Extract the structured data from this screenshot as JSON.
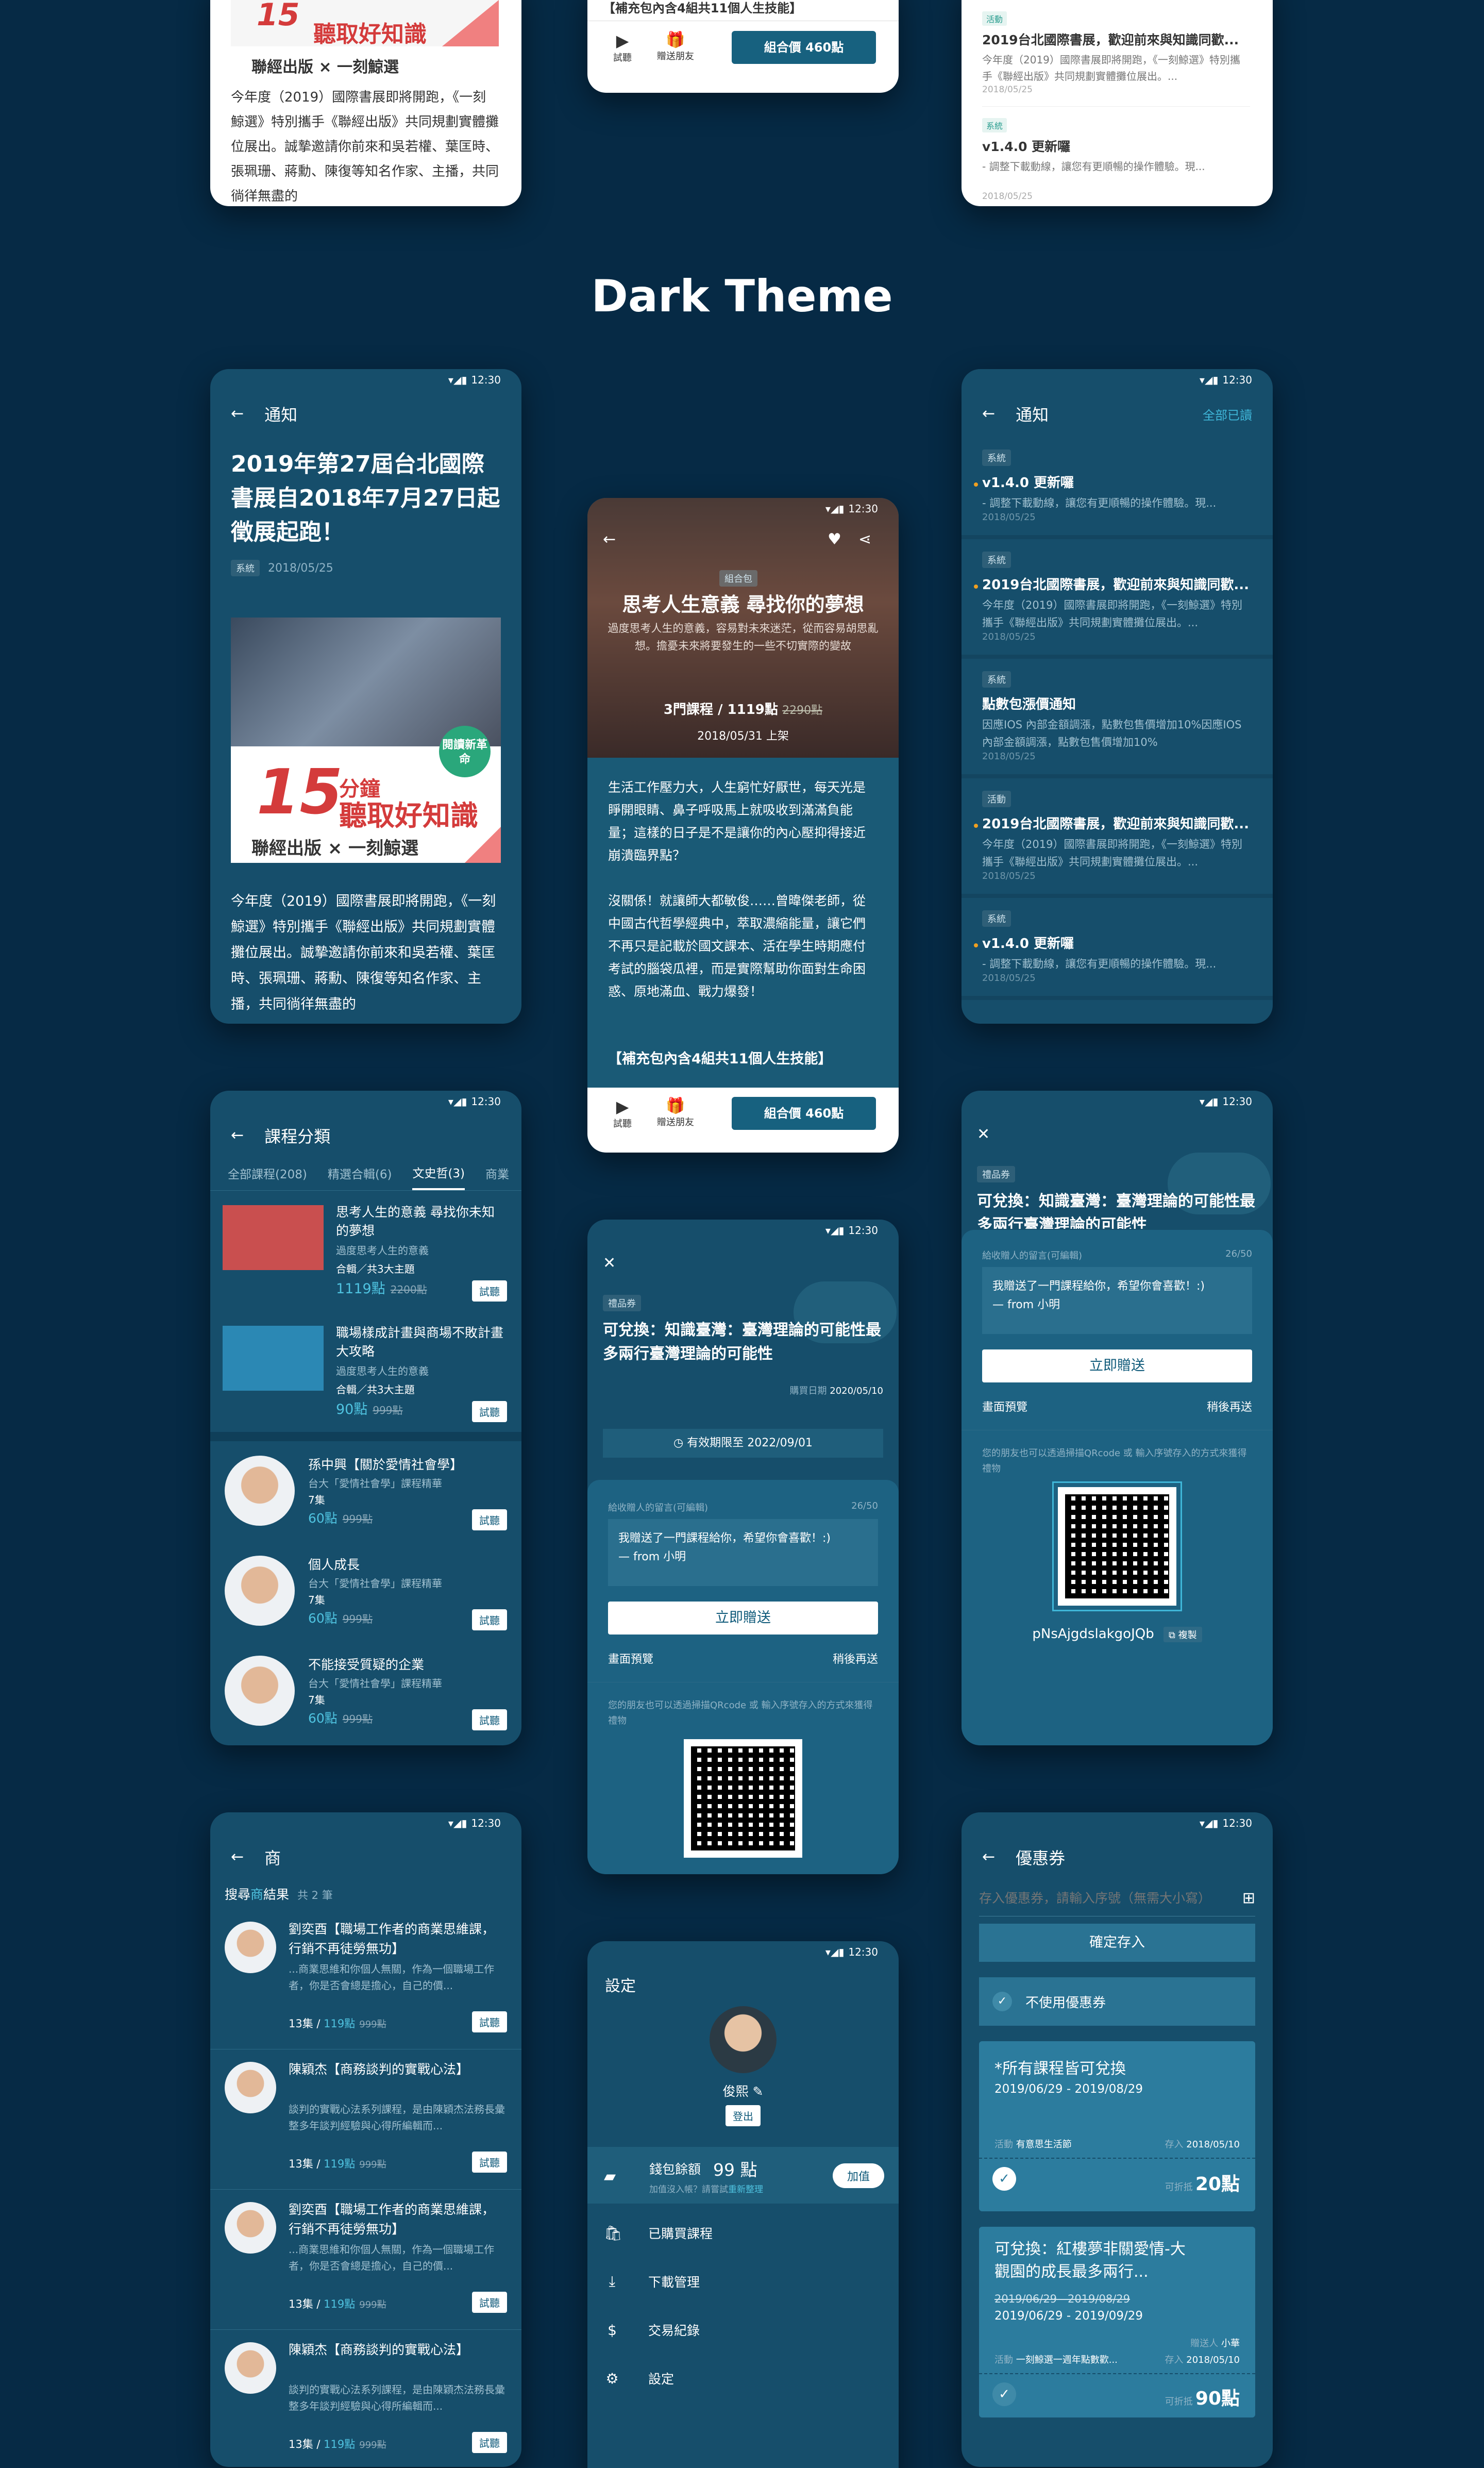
{
  "section_title": "Dark Theme",
  "status": {
    "time": "12:30"
  },
  "top": {
    "logo_caption": "聯經出版 × 一刻鯨選",
    "headline_frag": "聽取好知識",
    "headline_num": "15",
    "body": "今年度（2019）國際書展即將開跑，《一刻鯨選》特別攜手《聯經出版》共同規劃實體攤位展出。誠摯邀請你前來和吳若權、葉匡時、張珮珊、蔣勳、陳復等知名作家、主播，共同徜徉無盡的",
    "bundle_tail": "【補充包內含4組共11個人生技能】",
    "try_label": "試聽",
    "gift_label": "贈送朋友",
    "buy_label": "組合價 460點",
    "notif_items": [
      {
        "tag": "活動",
        "title": "2019台北國際書展，歡迎前來與知識同歡...",
        "desc": "今年度（2019）國際書展即將開跑，《一刻鯨選》特別攜手《聯經出版》共同規劃實體攤位展出。...",
        "date": "2018/05/25"
      },
      {
        "tag": "系統",
        "title": "v1.4.0 更新囉",
        "desc": "- 調整下載動線，讓您有更順暢的操作體驗。現...",
        "date": "2018/05/25"
      }
    ]
  },
  "article": {
    "nav_title": "通知",
    "title": "2019年第27屆台北國際書展自2018年7月27日起徵展起跑！",
    "tag": "系統",
    "date": "2018/05/25",
    "banner_tag": "閱讀新革命",
    "banner_num": "15",
    "banner_unit": "分鐘",
    "banner_text": "聽取好知識",
    "banner_logo": "聯經出版 × 一刻鯨選",
    "body": "今年度（2019）國際書展即將開跑，《一刻鯨選》特別攜手《聯經出版》共同規劃實體攤位展出。誠摯邀請你前來和吳若權、葉匡時、張珮珊、蔣勳、陳復等知名作家、主播，共同徜徉無盡的"
  },
  "bundle": {
    "tag": "組合包",
    "title": "思考人生意義 尋找你的夢想",
    "subtitle": "過度思考人生的意義，容易對未來迷茫，從而容易胡思亂想。擔憂未來將要發生的一些不切實際的變故",
    "count": "3門課程 / 1119點",
    "orig": "2290點",
    "date": "2018/05/31 上架",
    "p1": "生活工作壓力大，人生窮忙好厭世，每天光是睜開眼睛、鼻子呼吸馬上就吸收到滿滿負能量；這樣的日子是不是讓你的內心壓抑得接近崩潰臨界點？",
    "p2": "沒關係！就讓師大都敏俊……曾暐傑老師，從中國古代哲學經典中，萃取濃縮能量，讓它們不再只是記載於國文課本、活在學生時期應付考試的腦袋瓜裡，而是實際幫助你面對生命困惑、原地滿血、戰力爆發！",
    "tail": "【補充包內含4組共11個人生技能】",
    "try": "試聽",
    "gift": "贈送朋友",
    "buy": "組合價 460點"
  },
  "notif_list": {
    "nav_title": "通知",
    "mark_all": "全部已讀",
    "items": [
      {
        "tag": "系統",
        "title": "v1.4.0 更新囉",
        "desc": "- 調整下載動線，讓您有更順暢的操作體驗。現...",
        "date": "2018/05/25",
        "dot": true
      },
      {
        "tag": "系統",
        "title": "2019台北國際書展，歡迎前來與知識同歡...",
        "desc": "今年度（2019）國際書展即將開跑，《一刻鯨選》特別攜手《聯經出版》共同規劃實體攤位展出。...",
        "date": "2018/05/25",
        "dot": true
      },
      {
        "tag": "系統",
        "title": "點數包漲價通知",
        "desc": "因應IOS 內部金額調漲，點數包售價增加10%因應IOS 內部金額調漲，點數包售價增加10%",
        "date": "2018/05/25",
        "dot": false
      },
      {
        "tag": "活動",
        "title": "2019台北國際書展，歡迎前來與知識同歡...",
        "desc": "今年度（2019）國際書展即將開跑，《一刻鯨選》特別攜手《聯經出版》共同規劃實體攤位展出。...",
        "date": "2018/05/25",
        "dot": true
      },
      {
        "tag": "系統",
        "title": "v1.4.0 更新囉",
        "desc": "- 調整下載動線，讓您有更順暢的操作體驗。現...",
        "date": "2018/05/25",
        "dot": true
      }
    ]
  },
  "category": {
    "nav_title": "課程分類",
    "tabs": [
      "全部課程(208)",
      "精選合輯(6)",
      "文史哲(3)",
      "商業"
    ],
    "active_tab": 2,
    "try": "試聽",
    "bundles": [
      {
        "title": "思考人生的意義 尋找你未知的夢想",
        "sub": "過度思考人生的意義",
        "meta": "合輯／共3大主題",
        "price": "1119點",
        "orig": "2200點",
        "thumb": "#c94f4f"
      },
      {
        "title": "職場樣成計畫與商場不敗計畫大攻略",
        "sub": "過度思考人生的意義",
        "meta": "合輯／共3大主題",
        "price": "90點",
        "orig": "999點",
        "thumb": "#2b88b4"
      }
    ],
    "courses": [
      {
        "title": "孫中興【關於愛情社會學】",
        "sub": "台大「愛情社會學」課程精華",
        "meta": "7集",
        "price": "60點",
        "orig": "999點"
      },
      {
        "title": "個人成長",
        "sub": "台大「愛情社會學」課程精華",
        "meta": "7集",
        "price": "60點",
        "orig": "999點"
      },
      {
        "title": "不能接受質疑的企業",
        "sub": "台大「愛情社會學」課程精華",
        "meta": "7集",
        "price": "60點",
        "orig": "999點"
      }
    ]
  },
  "voucher": {
    "tag": "禮品券",
    "title": "可兌換：知識臺灣：臺灣理論的可能性最多兩行臺灣理論的可能性",
    "date_label": "購買日期",
    "date": "2020/05/10",
    "valid": "有效期限至 2022/09/01",
    "msg_label": "給收贈人的留言(可編輯)",
    "msg_count": "26/50",
    "msg": "我贈送了一門課程給你，希望你會喜歡！:)\n— from 小明",
    "send": "立即贈送",
    "preview": "畫面預覽",
    "later": "稍後再送",
    "qr_hint": "您的朋友也可以透過掃描QRcode 或 輸入序號存入的方式來獲得禮物",
    "code": "pNsAjgdslakgoJQb",
    "copy": "複製"
  },
  "search": {
    "nav_title": "商",
    "result_label": "搜尋",
    "result_kw": "商",
    "result_suffix": "結果",
    "result_count": "共 2 筆",
    "try": "試聽",
    "items": [
      {
        "title": "劉奕酉【職場工作者的商業思維課，行銷不再徒勞無功】",
        "desc": "...商業思維和你個人無關，作為一個職場工作者，你是否會總是擔心，自己的價...",
        "meta": "13集 / ",
        "price": "119點",
        "orig": "999點"
      },
      {
        "title": "陳穎杰【商務談判的實戰心法】",
        "desc": "談判的實戰心法系列課程，是由陳穎杰法務長彙整多年談判經驗與心得所編輯而...",
        "meta": "13集 / ",
        "price": "119點",
        "orig": "999點"
      },
      {
        "title": "劉奕酉【職場工作者的商業思維課，行銷不再徒勞無功】",
        "desc": "...商業思維和你個人無關，作為一個職場工作者，你是否會總是擔心，自己的價...",
        "meta": "13集 / ",
        "price": "119點",
        "orig": "999點"
      },
      {
        "title": "陳穎杰【商務談判的實戰心法】",
        "desc": "談判的實戰心法系列課程，是由陳穎杰法務長彙整多年談判經驗與心得所編輯而...",
        "meta": "13集 / ",
        "price": "119點",
        "orig": "999點"
      }
    ]
  },
  "settings": {
    "title": "設定",
    "name": "俊熙",
    "logout": "登出",
    "wallet_label": "錢包餘額",
    "wallet_value": "99 點",
    "wallet_hint": "加值沒入帳？請嘗試",
    "wallet_link": "重新整理",
    "topup": "加值",
    "menu": [
      "已購買課程",
      "下載管理",
      "交易紀錄",
      "設定"
    ]
  },
  "coupon": {
    "nav_title": "優惠券",
    "placeholder": "存入優惠券，請輸入序號（無需大小寫）",
    "confirm": "確定存入",
    "none": "不使用優惠券",
    "c1": {
      "title": "*所有課程皆可兌換",
      "range": "2019/06/29 - 2019/08/29",
      "act_label": "活動",
      "act": "有意思生活節",
      "save_label": "存入",
      "save": "2018/05/10",
      "off_label": "可折抵",
      "off": "20點"
    },
    "c2": {
      "title": "可兌換：紅樓夢非關愛情-大觀園的成長最多兩行...",
      "range_old": "2019/06/29 - 2019/08/29",
      "range": "2019/06/29 - 2019/09/29",
      "giver_label": "贈送人",
      "giver": "小華",
      "act_label": "活動",
      "act": "一刻鯨選一週年點數歡...",
      "save_label": "存入",
      "save": "2018/05/10",
      "off_label": "可折抵",
      "off": "90點"
    }
  }
}
